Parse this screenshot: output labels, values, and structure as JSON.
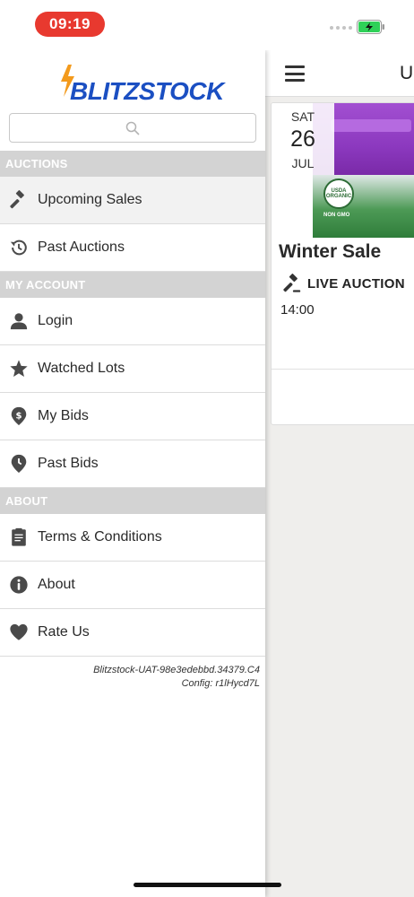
{
  "status_bar": {
    "time": "09:19"
  },
  "content": {
    "header_title": "U",
    "sale": {
      "date_dow": "SAT",
      "date_day": "26",
      "date_month": "JUL",
      "title": "Winter Sale",
      "type": "LIVE AUCTION",
      "time": "14:00",
      "image_badge": "USDA ORGANIC",
      "image_text": "NON GMO"
    }
  },
  "drawer": {
    "logo": "BLITZSTOCK",
    "search": {
      "placeholder": ""
    },
    "sections": [
      {
        "title": "AUCTIONS",
        "items": [
          {
            "label": "Upcoming Sales",
            "icon": "gavel-icon",
            "active": true
          },
          {
            "label": "Past Auctions",
            "icon": "history-icon"
          }
        ]
      },
      {
        "title": "MY ACCOUNT",
        "items": [
          {
            "label": "Login",
            "icon": "user-icon"
          },
          {
            "label": "Watched Lots",
            "icon": "star-icon"
          },
          {
            "label": "My Bids",
            "icon": "dollar-pin-icon"
          },
          {
            "label": "Past Bids",
            "icon": "clock-pin-icon"
          }
        ]
      },
      {
        "title": "ABOUT",
        "items": [
          {
            "label": "Terms & Conditions",
            "icon": "document-icon"
          },
          {
            "label": "About",
            "icon": "info-icon"
          },
          {
            "label": "Rate Us",
            "icon": "heart-icon"
          }
        ]
      }
    ],
    "version": "Blitzstock-UAT-98e3edebbd.34379.C4",
    "config": "Config: r1lHycd7L"
  },
  "colors": {
    "time_pill": "#e8392f",
    "section_header": "#d3d3d3",
    "logo_blue": "#1b4fc2",
    "logo_orange": "#f39a1c"
  }
}
